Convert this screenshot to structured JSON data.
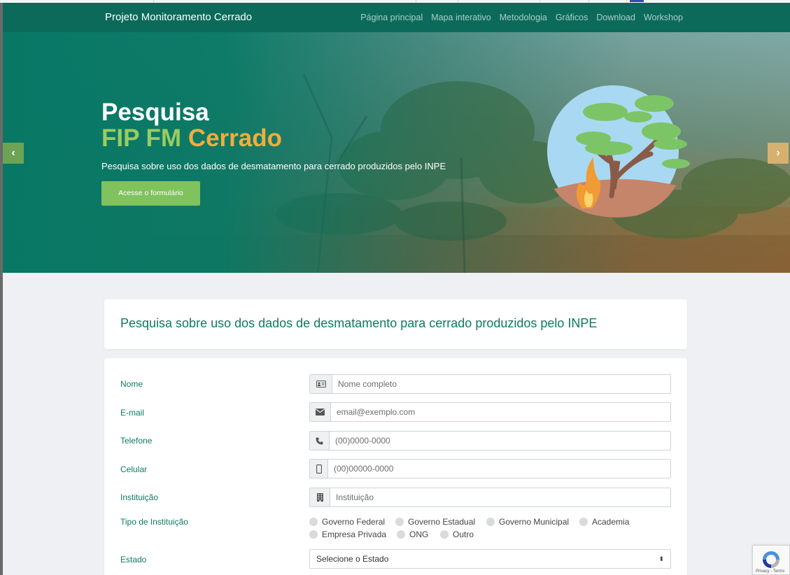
{
  "navbar": {
    "brand": "Projeto Monitoramento Cerrado",
    "links": [
      "Página principal",
      "Mapa interativo",
      "Metodologia",
      "Gráficos",
      "Download",
      "Workshop"
    ]
  },
  "hero": {
    "title_line1": "Pesquisa",
    "title_green": "FIP FM",
    "title_orange": "Cerrado",
    "subtitle": "Pesquisa sobre uso dos dados de desmatamento para cerrado produzidos pelo INPE",
    "button_label": "Acesse o formulário",
    "prev_icon": "chevron-left-icon",
    "next_icon": "chevron-right-icon"
  },
  "survey": {
    "title": "Pesquisa sobre uso dos dados de desmatamento para cerrado produzidos pelo INPE"
  },
  "form": {
    "nome": {
      "label": "Nome",
      "placeholder": "Nome completo",
      "icon": "id-card-icon"
    },
    "email": {
      "label": "E-mail",
      "placeholder": "email@exemplo.com",
      "icon": "envelope-icon"
    },
    "telefone": {
      "label": "Telefone",
      "placeholder": "(00)0000-0000",
      "icon": "phone-icon"
    },
    "celular": {
      "label": "Celular",
      "placeholder": "(00)00000-0000",
      "icon": "mobile-icon"
    },
    "instituicao": {
      "label": "Instituição",
      "placeholder": "Instituição",
      "icon": "building-icon"
    },
    "tipo": {
      "label": "Tipo de Instituição",
      "options": [
        "Governo Federal",
        "Governo Estadual",
        "Governo Municipal",
        "Academia",
        "Empresa Privada",
        "ONG",
        "Outro"
      ]
    },
    "estado": {
      "label": "Estado",
      "selected": "Selecione o Estado"
    }
  },
  "recaptcha": {
    "text": "Privacy - Terms"
  },
  "colors": {
    "accent": "#0c7a63",
    "navbar": "#0c6a5b",
    "button": "#80c25d",
    "orange": "#f1ad3b",
    "green": "#9ccb5f"
  }
}
